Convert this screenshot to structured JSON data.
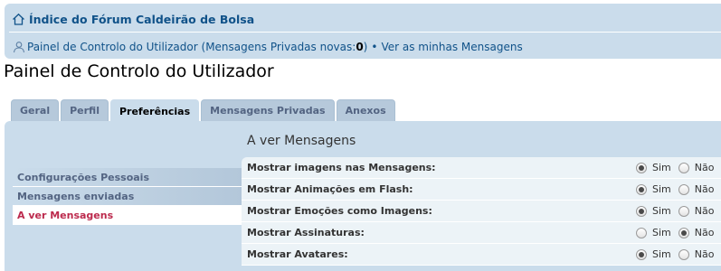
{
  "header": {
    "forum_index_label": "Índice do Fórum Caldeirão de Bolsa",
    "ucp_link_label": "Painel de Controlo do Utilizador",
    "pm_prefix": "(Mensagens Privadas novas: ",
    "pm_count": "0",
    "pm_suffix": ")",
    "separator": "•",
    "view_messages_label": "Ver as minhas Mensagens"
  },
  "page_title": "Painel de Controlo do Utilizador",
  "tabs": [
    {
      "label": "Geral",
      "active": false
    },
    {
      "label": "Perfil",
      "active": false
    },
    {
      "label": "Preferências",
      "active": true
    },
    {
      "label": "Mensagens Privadas",
      "active": false
    },
    {
      "label": "Anexos",
      "active": false
    }
  ],
  "side_menu": [
    {
      "label": "Configurações Pessoais",
      "active": false
    },
    {
      "label": "Mensagens enviadas",
      "active": false
    },
    {
      "label": "A ver Mensagens",
      "active": true
    }
  ],
  "content": {
    "title": "A ver Mensagens",
    "options": [
      {
        "label": "Mostrar imagens nas Mensagens:",
        "yes": "Sim",
        "no": "Não",
        "selected": "yes"
      },
      {
        "label": "Mostrar Animações em Flash:",
        "yes": "Sim",
        "no": "Não",
        "selected": "yes"
      },
      {
        "label": "Mostrar Emoções como Imagens:",
        "yes": "Sim",
        "no": "Não",
        "selected": "yes"
      },
      {
        "label": "Mostrar Assinaturas:",
        "yes": "Sim",
        "no": "Não",
        "selected": "no"
      },
      {
        "label": "Mostrar Avatares:",
        "yes": "Sim",
        "no": "Não",
        "selected": "yes"
      }
    ]
  },
  "icons": {
    "home": "home-icon",
    "user": "user-icon"
  },
  "colors": {
    "header_bg": "#cadceb",
    "link": "#105289",
    "active_menu_text": "#bc2a4d",
    "content_bg": "#ecf3f7"
  }
}
